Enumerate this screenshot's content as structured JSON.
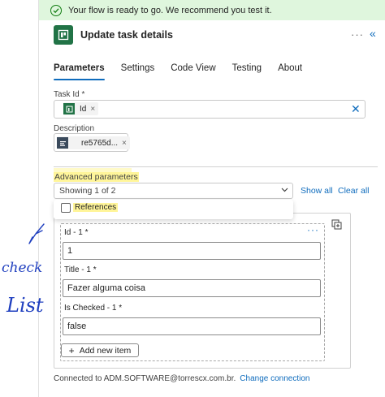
{
  "banner": {
    "message": "Your flow is ready to go. We recommend you test it."
  },
  "panel": {
    "title": "Update task details",
    "more": "···",
    "collapse": "«"
  },
  "tabs": [
    {
      "label": "Parameters",
      "active": true
    },
    {
      "label": "Settings",
      "active": false
    },
    {
      "label": "Code View",
      "active": false
    },
    {
      "label": "Testing",
      "active": false
    },
    {
      "label": "About",
      "active": false
    }
  ],
  "task_id": {
    "label": "Task Id *",
    "token": "Id"
  },
  "description": {
    "label": "Description",
    "token": "re5765d..."
  },
  "advanced": {
    "label": "Advanced parameters",
    "select_value": "Showing 1 of 2",
    "show_all": "Show all",
    "clear_all": "Clear all",
    "option": "References"
  },
  "item": {
    "more": "···",
    "fields": [
      {
        "label": "Id - 1 *",
        "value": "1"
      },
      {
        "label": "Title - 1 *",
        "value": "Fazer alguma coisa"
      },
      {
        "label": "Is Checked - 1 *",
        "value": "false"
      }
    ],
    "add_label": "Add new item"
  },
  "footer": {
    "text": "Connected to ADM.SOFTWARE@torrescx.com.br.",
    "link": "Change connection"
  },
  "annotation": {
    "handwriting": [
      "check",
      "List"
    ],
    "color": "#1f3fbf"
  },
  "colors": {
    "accent": "#0f6cbd",
    "success_bg": "#dff6dd",
    "highlight": "#fff59a",
    "app": "#217346"
  }
}
